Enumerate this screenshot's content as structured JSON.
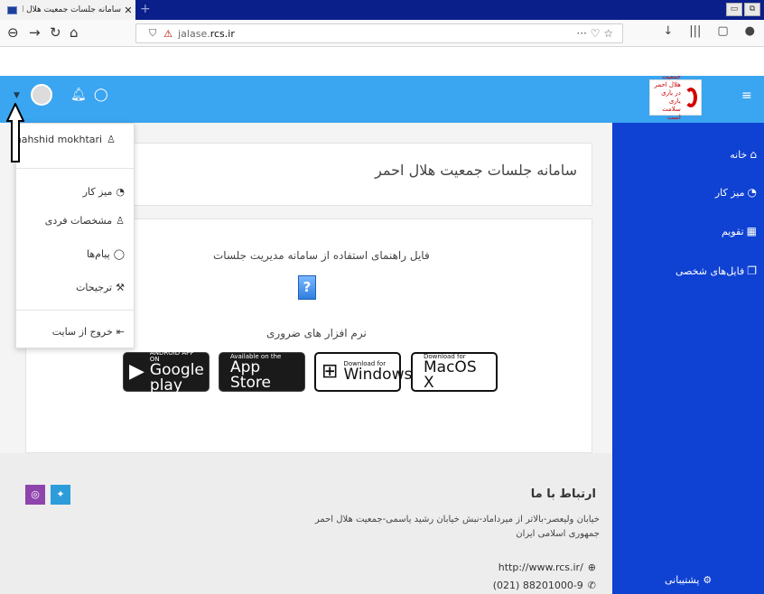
{
  "browser": {
    "tab_title": "سامانه جلسات جمعیت هلال احمر",
    "tab_close": "✕",
    "new_tab": "+",
    "url_host_prefix": "jalase.",
    "url_host_bold": "rcs.ir",
    "url_actions": "··· ♡ ☆",
    "toolbar_icons": [
      "↓",
      "|||",
      "▢",
      "●"
    ]
  },
  "header": {
    "logo_text_line1": "جمعیت هلال احمر",
    "logo_text_line2": "در یاری یاری سلامت است",
    "hamburger": "≡"
  },
  "dropdown": {
    "username": "mahshid mokhtari",
    "items": [
      {
        "label": "میز کار",
        "icon": "dashboard-icon"
      },
      {
        "label": "مشخصات فردی",
        "icon": "user-icon"
      },
      {
        "label": "پیام‌ها",
        "icon": "chat-icon"
      },
      {
        "label": "ترجیحات",
        "icon": "wrench-icon"
      }
    ],
    "logout": "خروج از سایت"
  },
  "sidebar": {
    "items": [
      {
        "label": "خانه",
        "icon": "home-icon"
      },
      {
        "label": "میز کار",
        "icon": "dashboard-icon"
      },
      {
        "label": "تقویم",
        "icon": "calendar-icon"
      },
      {
        "label": "فایل‌های شخصی",
        "icon": "files-icon"
      }
    ],
    "support": "پشتیبانی"
  },
  "main": {
    "page_title": "سامانه جلسات جمعیت هلال احمر",
    "guide_label": "فایل راهنمای استفاده از سامانه مدیریت جلسات",
    "software_label": "نرم افزار های ضروری",
    "stores": [
      {
        "small": "ANDROID APP ON",
        "big": "Google play"
      },
      {
        "small": "Available on the",
        "big": "App Store"
      },
      {
        "small": "Download for",
        "big": "Windows"
      },
      {
        "small": "Download for",
        "big": "MacOS X"
      }
    ]
  },
  "footer": {
    "contact_title": "ارتباط با ما",
    "address": "خیابان ولیعصر-بالاتر از میرداماد-نبش خیابان رشید یاسمی-جمعیت هلال احمر جمهوری اسلامی ایران",
    "website": "http://www.rcs.ir/",
    "phone": "(021) 88201000-9"
  },
  "colors": {
    "header": "#3aa5f0",
    "sidebar": "#0f41d2",
    "instagram": "#8e44ad",
    "twitter": "#2d9cdb"
  }
}
